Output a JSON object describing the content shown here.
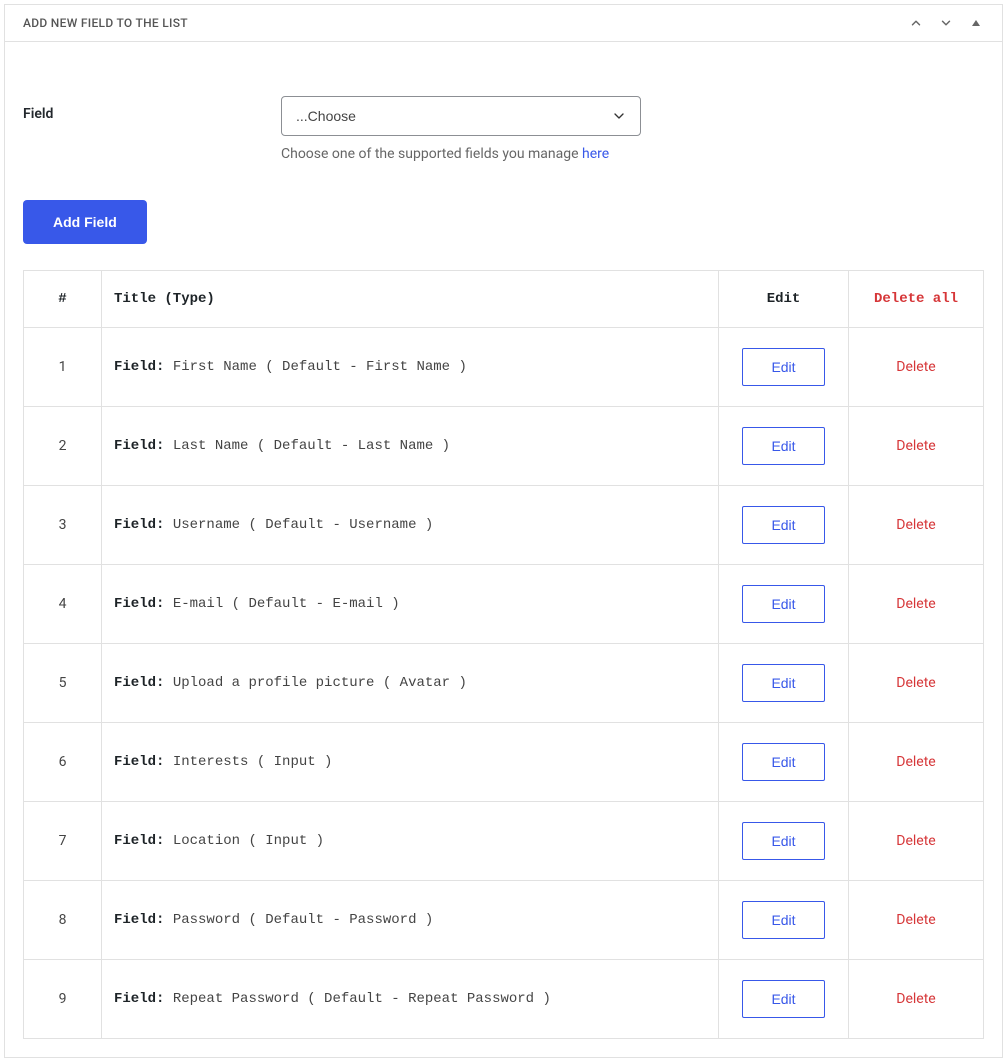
{
  "panel": {
    "title": "ADD NEW FIELD TO THE LIST"
  },
  "form": {
    "field_label": "Field",
    "select_placeholder": "...Choose",
    "helper_prefix": "Choose one of the supported fields you manage ",
    "helper_link": "here",
    "add_button": "Add Field"
  },
  "table": {
    "headers": {
      "index": "#",
      "title": "Title (Type)",
      "edit": "Edit",
      "delete_all": "Delete all"
    },
    "row_label": "Field:",
    "edit_label": "Edit",
    "delete_label": "Delete",
    "rows": [
      {
        "n": "1",
        "text": "First Name ( Default - First Name )"
      },
      {
        "n": "2",
        "text": "Last Name ( Default - Last Name )"
      },
      {
        "n": "3",
        "text": "Username ( Default - Username )"
      },
      {
        "n": "4",
        "text": "E-mail ( Default - E-mail )"
      },
      {
        "n": "5",
        "text": "Upload a profile picture ( Avatar )"
      },
      {
        "n": "6",
        "text": "Interests ( Input )"
      },
      {
        "n": "7",
        "text": "Location ( Input )"
      },
      {
        "n": "8",
        "text": "Password ( Default - Password )"
      },
      {
        "n": "9",
        "text": "Repeat Password ( Default - Repeat Password )"
      }
    ]
  }
}
